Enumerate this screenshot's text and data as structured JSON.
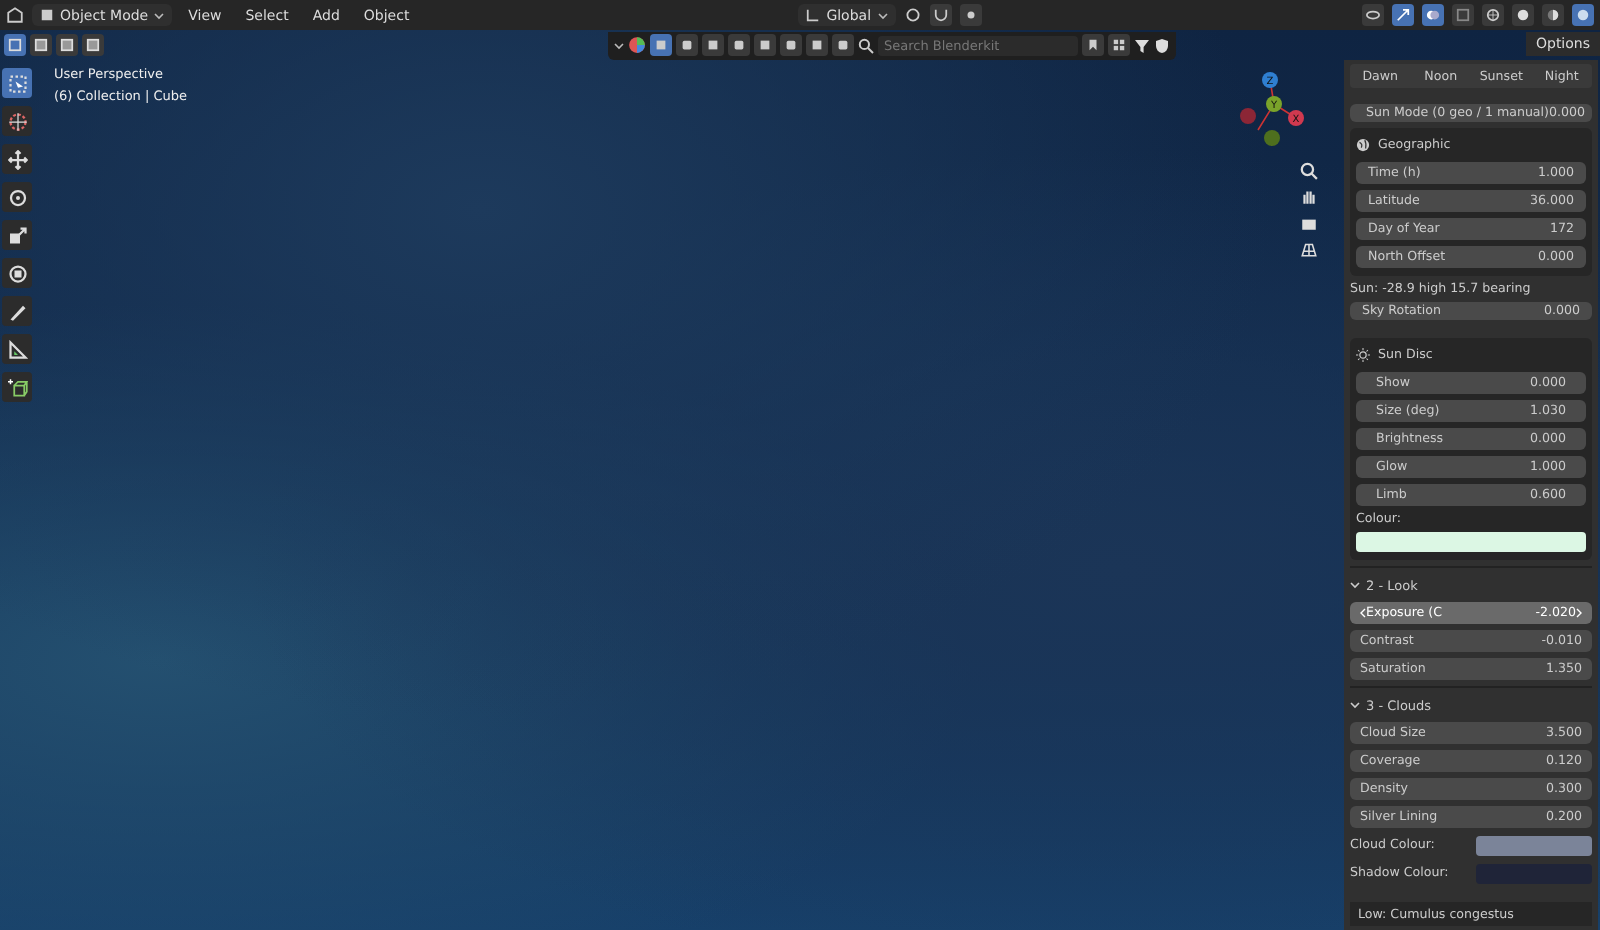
{
  "header": {
    "mode": "Object Mode",
    "menus": [
      "View",
      "Select",
      "Add",
      "Object"
    ],
    "orientation": "Global"
  },
  "subheader": {
    "search": {
      "placeholder": "Search Blenderkit"
    },
    "options": "Options"
  },
  "tools": [
    {
      "kind": "select",
      "selected": true
    },
    {
      "kind": "cursor",
      "selected": false
    },
    {
      "kind": "move",
      "selected": false
    },
    {
      "kind": "rotate",
      "selected": false
    },
    {
      "kind": "scale",
      "selected": false
    },
    {
      "kind": "transform",
      "selected": false
    },
    {
      "kind": "annotate",
      "selected": false
    },
    {
      "kind": "measure",
      "selected": false
    },
    {
      "kind": "add_cube",
      "selected": false
    }
  ],
  "viewport": {
    "overlay": [
      "User Perspective",
      "(6) Collection | Cube"
    ],
    "gizmo": [
      "Z",
      "Y",
      "X"
    ]
  },
  "panel": {
    "presets": [
      "Dawn",
      "Noon",
      "Sunset",
      "Night"
    ],
    "sun_mode": {
      "label": "Sun Mode (0 geo / 1 manual)",
      "value": "0.000"
    },
    "geographic": {
      "title": "Geographic",
      "fields": [
        {
          "label": "Time (h)",
          "value": "1.000"
        },
        {
          "label": "Latitude",
          "value": "36.000"
        },
        {
          "label": "Day of Year",
          "value": "172"
        },
        {
          "label": "North Offset",
          "value": "0.000"
        }
      ]
    },
    "sun_info": "Sun:  -28.9 high  15.7 bearing",
    "sky_rotation": {
      "label": "Sky Rotation",
      "value": "0.000"
    },
    "sun_disc": {
      "title": "Sun Disc",
      "fields": [
        {
          "label": "Show",
          "value": "0.000"
        },
        {
          "label": "Size (deg)",
          "value": "1.030"
        },
        {
          "label": "Brightness",
          "value": "0.000"
        },
        {
          "label": "Glow",
          "value": "1.000"
        },
        {
          "label": "Limb",
          "value": "0.600"
        }
      ],
      "colour_label": "Colour:",
      "color": "#dcf7e4"
    },
    "look": {
      "title": "2 - Look",
      "expanded": true,
      "fields": [
        {
          "label": "Exposure (C",
          "value": "-2.020",
          "active": true
        },
        {
          "label": "Contrast",
          "value": "-0.010",
          "active": false
        },
        {
          "label": "Saturation",
          "value": "1.350",
          "active": false
        }
      ]
    },
    "clouds": {
      "title": "3 - Clouds",
      "expanded": true,
      "fields": [
        {
          "label": "Cloud Size",
          "value": "3.500"
        },
        {
          "label": "Coverage",
          "value": "0.120"
        },
        {
          "label": "Density",
          "value": "0.300"
        },
        {
          "label": "Silver Lining",
          "value": "0.200"
        }
      ],
      "colours": [
        {
          "label": "Cloud Colour:",
          "color": "#7b8499"
        },
        {
          "label": "Shadow Colour:",
          "color": "#1f2438"
        }
      ]
    },
    "cloud_type": "Low: Cumulus congestus"
  }
}
